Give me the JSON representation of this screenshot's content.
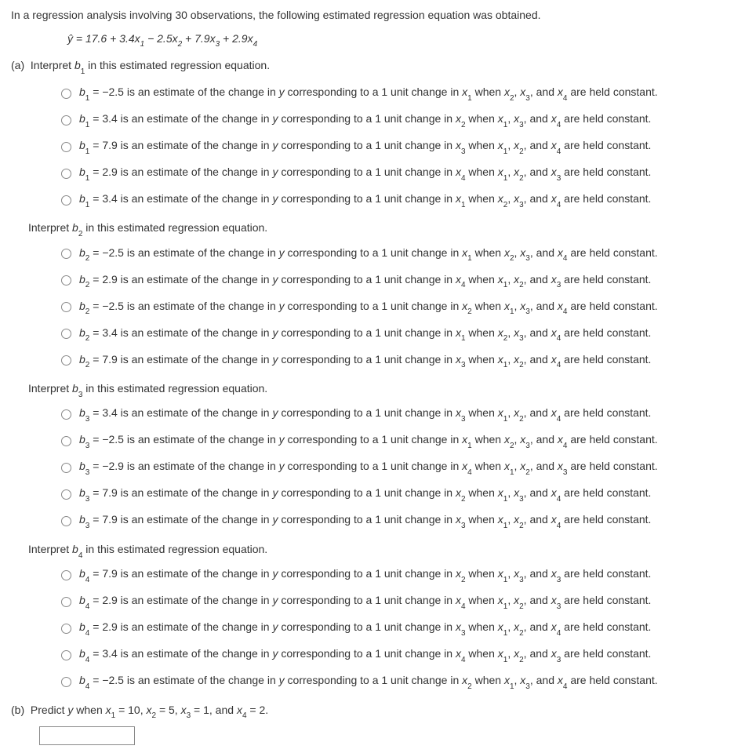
{
  "intro": "In a regression analysis involving 30 observations, the following estimated regression equation was obtained.",
  "equation": "ŷ = 17.6 + 3.4x₁ − 2.5x₂ + 7.9x₃ + 2.9x₄",
  "parts": {
    "a": {
      "label": "(a)",
      "q1": {
        "prompt": "Interpret b₁ in this estimated regression equation.",
        "options": [
          "b₁ = −2.5 is an estimate of the change in y corresponding to a 1 unit change in x₁ when x₂, x₃, and x₄ are held constant.",
          "b₁ = 3.4 is an estimate of the change in y corresponding to a 1 unit change in x₂ when x₁, x₃, and x₄ are held constant.",
          "b₁ = 7.9 is an estimate of the change in y corresponding to a 1 unit change in x₃ when x₁, x₂, and x₄ are held constant.",
          "b₁ = 2.9 is an estimate of the change in y corresponding to a 1 unit change in x₄ when x₁, x₂, and x₃ are held constant.",
          "b₁ = 3.4 is an estimate of the change in y corresponding to a 1 unit change in x₁ when x₂, x₃, and x₄ are held constant."
        ]
      },
      "q2": {
        "prompt": "Interpret b₂ in this estimated regression equation.",
        "options": [
          "b₂ = −2.5 is an estimate of the change in y corresponding to a 1 unit change in x₁ when x₂, x₃, and x₄ are held constant.",
          "b₂ = 2.9 is an estimate of the change in y corresponding to a 1 unit change in x₄ when x₁, x₂, and x₃ are held constant.",
          "b₂ = −2.5 is an estimate of the change in y corresponding to a 1 unit change in x₂ when x₁, x₃, and x₄ are held constant.",
          "b₂ = 3.4 is an estimate of the change in y corresponding to a 1 unit change in x₁ when x₂, x₃, and x₄ are held constant.",
          "b₂ = 7.9 is an estimate of the change in y corresponding to a 1 unit change in x₃ when x₁, x₂, and x₄ are held constant."
        ]
      },
      "q3": {
        "prompt": "Interpret b₃ in this estimated regression equation.",
        "options": [
          "b₃ = 3.4 is an estimate of the change in y corresponding to a 1 unit change in x₃ when x₁, x₂, and x₄ are held constant.",
          "b₃ = −2.5 is an estimate of the change in y corresponding to a 1 unit change in x₁ when x₂, x₃, and x₄ are held constant.",
          "b₃ = −2.9 is an estimate of the change in y corresponding to a 1 unit change in x₄ when x₁, x₂, and x₃ are held constant.",
          "b₃ = 7.9 is an estimate of the change in y corresponding to a 1 unit change in x₂ when x₁, x₃, and x₄ are held constant.",
          "b₃ = 7.9 is an estimate of the change in y corresponding to a 1 unit change in x₃ when x₁, x₂, and x₄ are held constant."
        ]
      },
      "q4": {
        "prompt": "Interpret b₄ in this estimated regression equation.",
        "options": [
          "b₄ = 7.9 is an estimate of the change in y corresponding to a 1 unit change in x₂ when x₁, x₃, and x₃ are held constant.",
          "b₄ = 2.9 is an estimate of the change in y corresponding to a 1 unit change in x₄ when x₁, x₂, and x₃ are held constant.",
          "b₄ = 2.9 is an estimate of the change in y corresponding to a 1 unit change in x₃ when x₁, x₂, and x₄ are held constant.",
          "b₄ = 3.4 is an estimate of the change in y corresponding to a 1 unit change in x₄ when x₁, x₂, and x₃ are held constant.",
          "b₄ = −2.5 is an estimate of the change in y corresponding to a 1 unit change in x₂ when x₁, x₃, and x₄ are held constant."
        ]
      }
    },
    "b": {
      "label": "(b)",
      "prompt": "Predict y when x₁ = 10, x₂ = 5, x₃ = 1, and x₄ = 2."
    }
  }
}
